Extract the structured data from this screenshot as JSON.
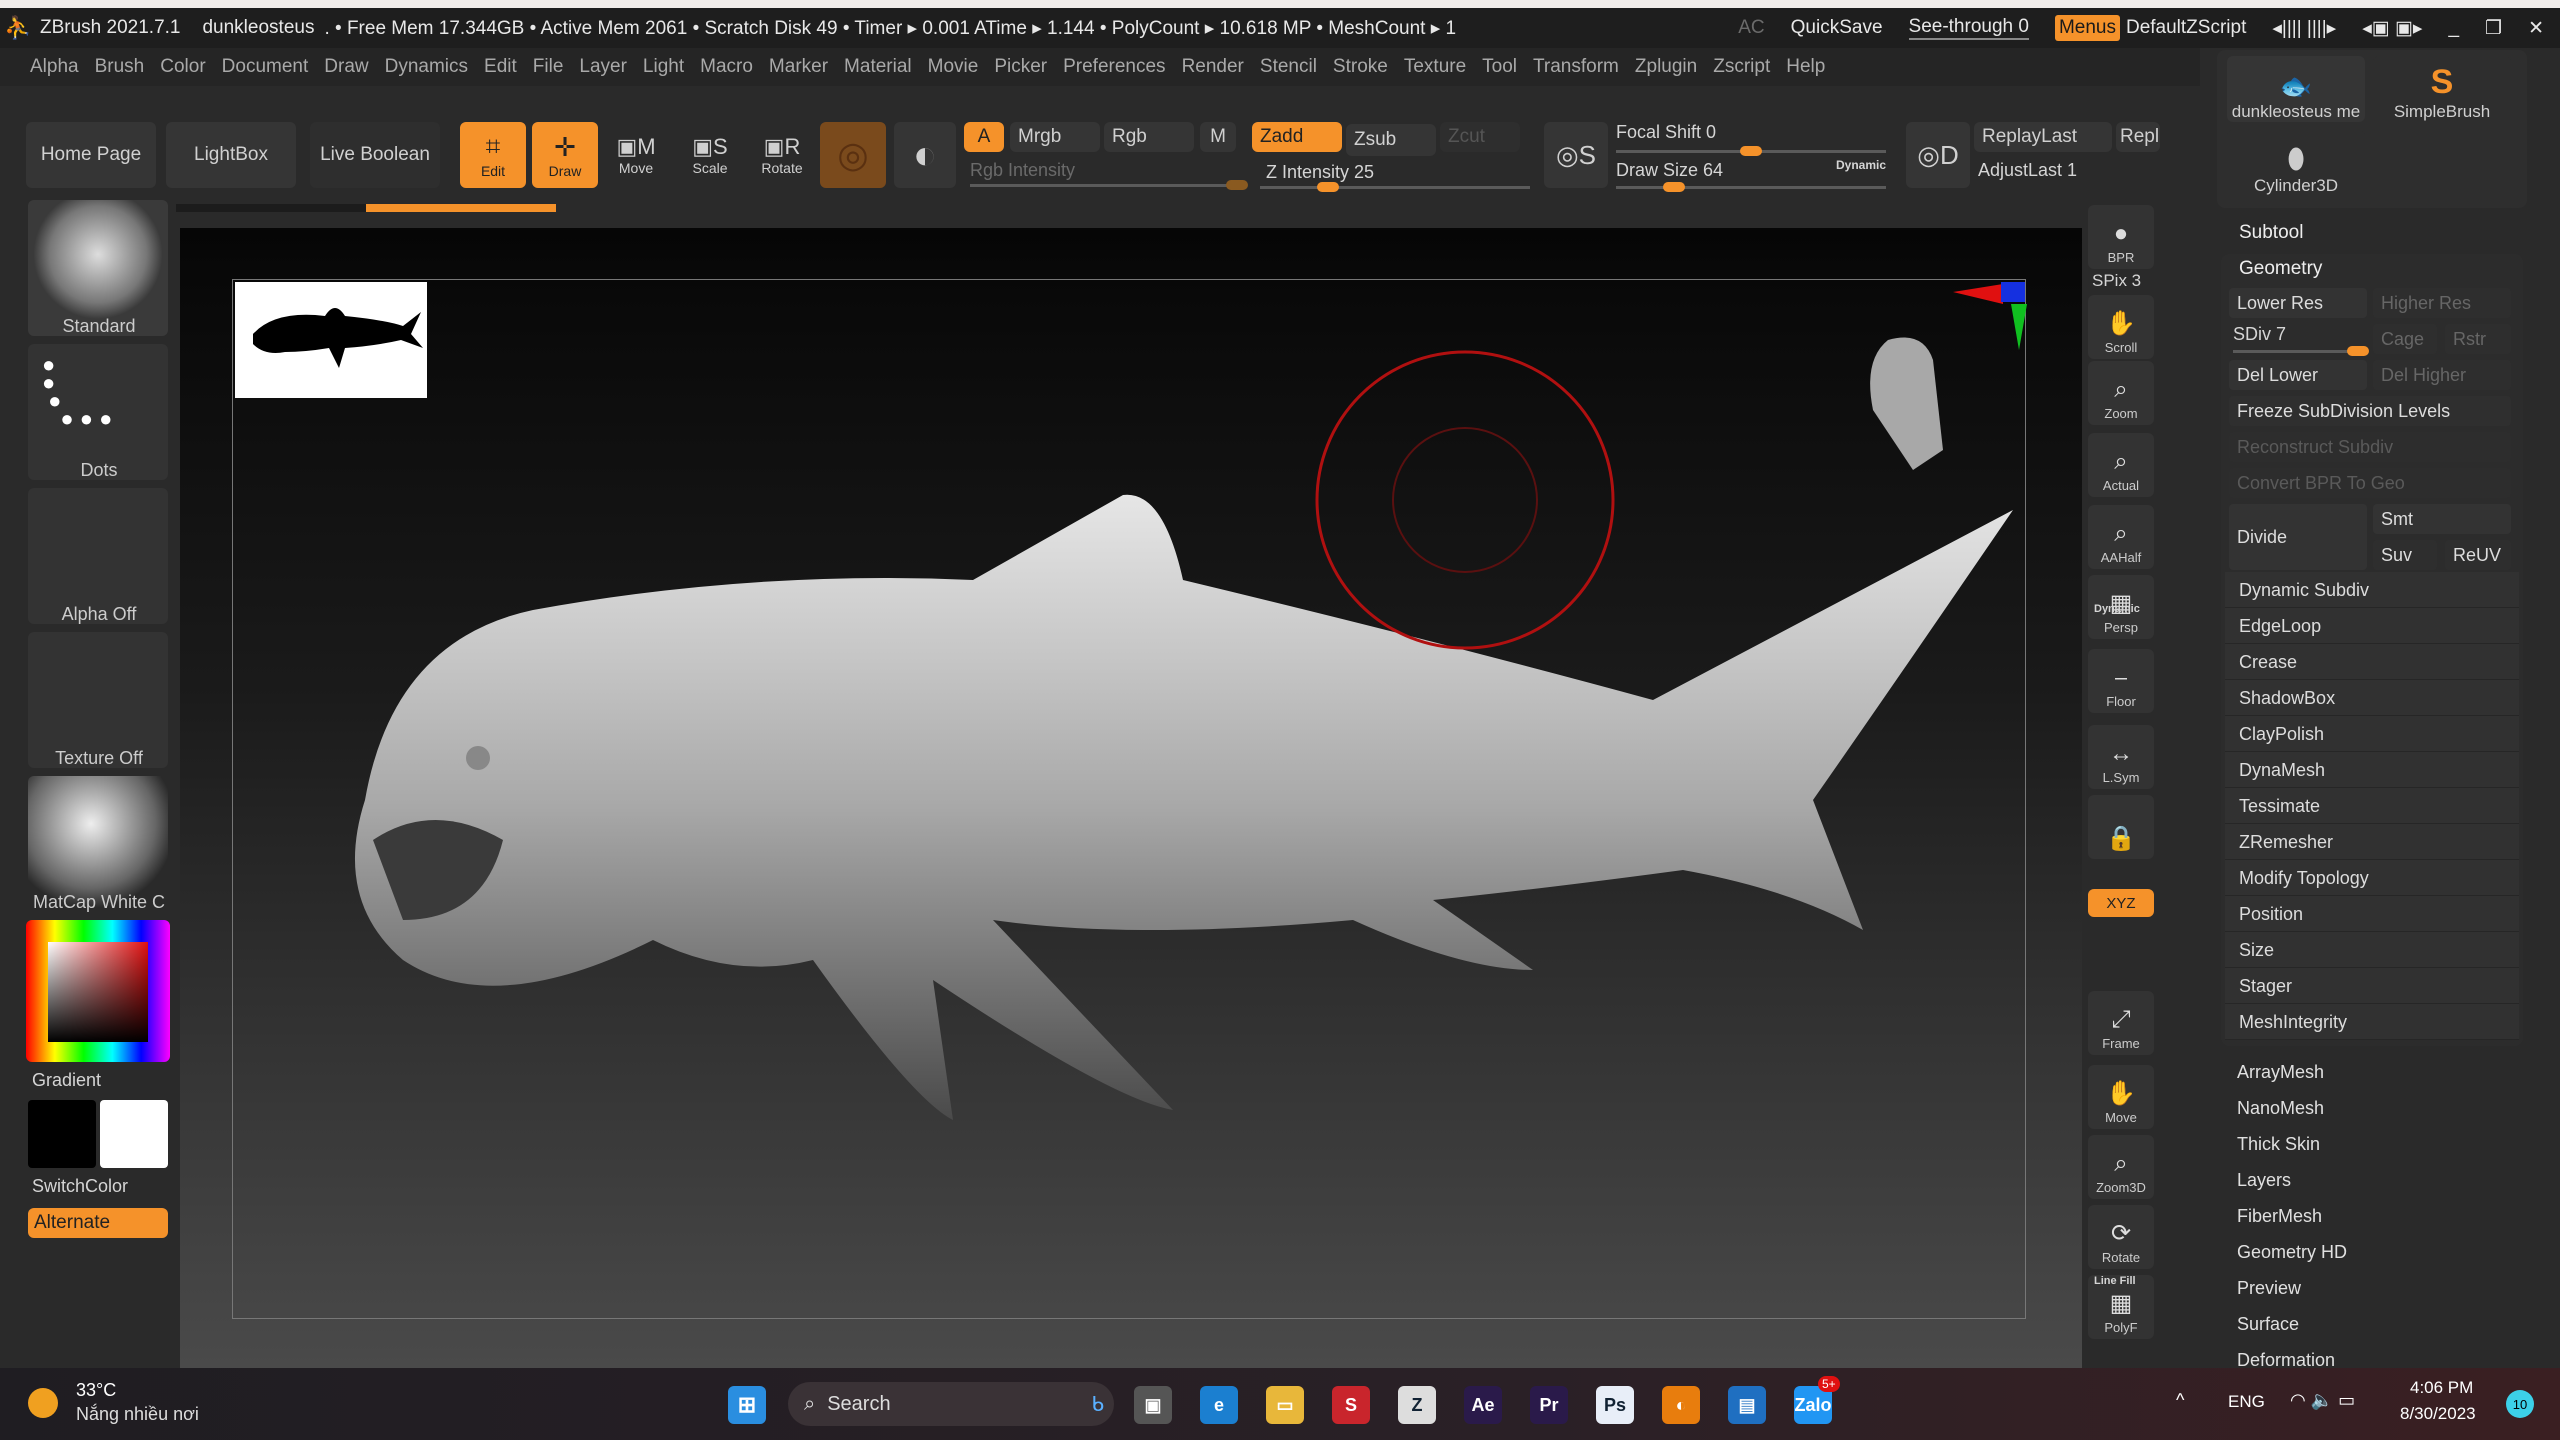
{
  "titlebar": {
    "app": "ZBrush 2021.7.1",
    "doc": "dunkleosteus",
    "stats": ". • Free Mem 17.344GB • Active Mem 2061 • Scratch Disk 49 •  Timer ▸ 0.001 ATime ▸ 1.144 • PolyCount ▸ 10.618 MP • MeshCount ▸ 1",
    "ac": "AC",
    "quicksave": "QuickSave",
    "seethrough": "See-through  0",
    "menus": "Menus",
    "script": "DefaultZScript"
  },
  "menus": [
    "Alpha",
    "Brush",
    "Color",
    "Document",
    "Draw",
    "Dynamics",
    "Edit",
    "File",
    "Layer",
    "Light",
    "Macro",
    "Marker",
    "Material",
    "Movie",
    "Picker",
    "Preferences",
    "Render",
    "Stencil",
    "Stroke",
    "Texture",
    "Tool",
    "Transform",
    "Zplugin",
    "Zscript",
    "Help"
  ],
  "toolbar": {
    "home": "Home Page",
    "lightbox": "LightBox",
    "liveboolean": "Live Boolean",
    "edit": "Edit",
    "draw": "Draw",
    "move": "Move",
    "scale": "Scale",
    "rotate": "Rotate",
    "a": "A",
    "mrgb": "Mrgb",
    "rgb": "Rgb",
    "m": "M",
    "zadd": "Zadd",
    "zsub": "Zsub",
    "zcut": "Zcut",
    "rgb_intensity": "Rgb Intensity",
    "z_intensity": "Z Intensity 25",
    "focal_shift": "Focal Shift 0",
    "draw_size": "Draw Size 64",
    "dynamic": "Dynamic",
    "replay_last": "ReplayLast",
    "repl": "Repl",
    "adjust_last": "AdjustLast 1",
    "z_intensity_value": 25,
    "focal_shift_value": 0,
    "draw_size_value": 64
  },
  "leftshelf": {
    "brush": "Standard",
    "stroke": "Dots",
    "alpha": "Alpha Off",
    "texture": "Texture Off",
    "material": "MatCap White C",
    "gradient": "Gradient",
    "switchcolor": "SwitchColor",
    "alternate": "Alternate"
  },
  "righttools": [
    {
      "label": "BPR",
      "icon": "bpr-icon"
    },
    {
      "label": "Scroll",
      "icon": "scroll-icon"
    },
    {
      "label": "Zoom",
      "icon": "zoom-icon"
    },
    {
      "label": "Actual",
      "icon": "actual-icon"
    },
    {
      "label": "AAHalf",
      "icon": "aahalf-icon"
    },
    {
      "label": "Persp",
      "icon": "persp-icon"
    },
    {
      "label": "Floor",
      "icon": "floor-icon"
    },
    {
      "label": "L.Sym",
      "icon": "lsym-icon"
    },
    {
      "label": "",
      "icon": "lock-camera-icon"
    },
    {
      "label": "Frame",
      "icon": "frame-icon"
    },
    {
      "label": "Move",
      "icon": "move-icon"
    },
    {
      "label": "Zoom3D",
      "icon": "zoom3d-icon"
    },
    {
      "label": "Rotate",
      "icon": "rotate-icon"
    },
    {
      "label": "PolyF",
      "icon": "polyf-icon"
    }
  ],
  "rt_extra": {
    "spix": "SPix 3",
    "xyz": "XYZ",
    "dynamic": "Dynamic",
    "linefill": "Line Fill"
  },
  "rightpanel": {
    "tools": [
      "dunkleosteus me",
      "SimpleBrush",
      "Cylinder3D"
    ],
    "subtool": "Subtool",
    "geometry": "Geometry",
    "lower_res": "Lower Res",
    "higher_res": "Higher Res",
    "sdiv": "SDiv 7",
    "cage": "Cage",
    "rstr": "Rstr",
    "del_lower": "Del Lower",
    "del_higher": "Del Higher",
    "freeze": "Freeze SubDivision Levels",
    "reconstruct": "Reconstruct Subdiv",
    "convert_bpr": "Convert BPR To Geo",
    "divide": "Divide",
    "smt": "Smt",
    "suv": "Suv",
    "reuv": "ReUV",
    "geo_items": [
      "Dynamic Subdiv",
      "EdgeLoop",
      "Crease",
      "ShadowBox",
      "ClayPolish",
      "DynaMesh",
      "Tessimate",
      "ZRemesher",
      "Modify Topology",
      "Position",
      "Size",
      "Stager",
      "MeshIntegrity"
    ],
    "sub_items": [
      "ArrayMesh",
      "NanoMesh",
      "Thick Skin",
      "Layers",
      "FiberMesh",
      "Geometry HD",
      "Preview",
      "Surface",
      "Deformation"
    ]
  },
  "taskbar": {
    "temp": "33°C",
    "weather": "Nắng nhiều nơi",
    "search": "Search",
    "lang": "ENG",
    "time": "4:06 PM",
    "date": "8/30/2023",
    "badge": "10",
    "apps": [
      {
        "icon": "task-view-icon",
        "t": "▣",
        "c": "#555"
      },
      {
        "icon": "edge-icon",
        "t": "e",
        "c": "#1b7fd0"
      },
      {
        "icon": "file-explorer-icon",
        "t": "▭",
        "c": "#e8b73a"
      },
      {
        "icon": "app-s-icon",
        "t": "S",
        "c": "#c9252c"
      },
      {
        "icon": "zbrush-icon",
        "t": "Z",
        "c": "#ddd"
      },
      {
        "icon": "after-effects-icon",
        "t": "Ae",
        "c": "#2a1a4a"
      },
      {
        "icon": "premiere-icon",
        "t": "Pr",
        "c": "#2a1a4a"
      },
      {
        "icon": "photoshop-icon",
        "t": "Ps",
        "c": "#e8eef8"
      },
      {
        "icon": "blender-icon",
        "t": "◐",
        "c": "#e87d0d"
      },
      {
        "icon": "remote-desktop-icon",
        "t": "▤",
        "c": "#1f6fc1"
      },
      {
        "icon": "zalo-icon",
        "t": "Zalo",
        "c": "#2196f3"
      }
    ],
    "zalo_badge": "5+"
  },
  "colors": {
    "accent": "#f5922a",
    "bg": "#2a2a2a"
  }
}
